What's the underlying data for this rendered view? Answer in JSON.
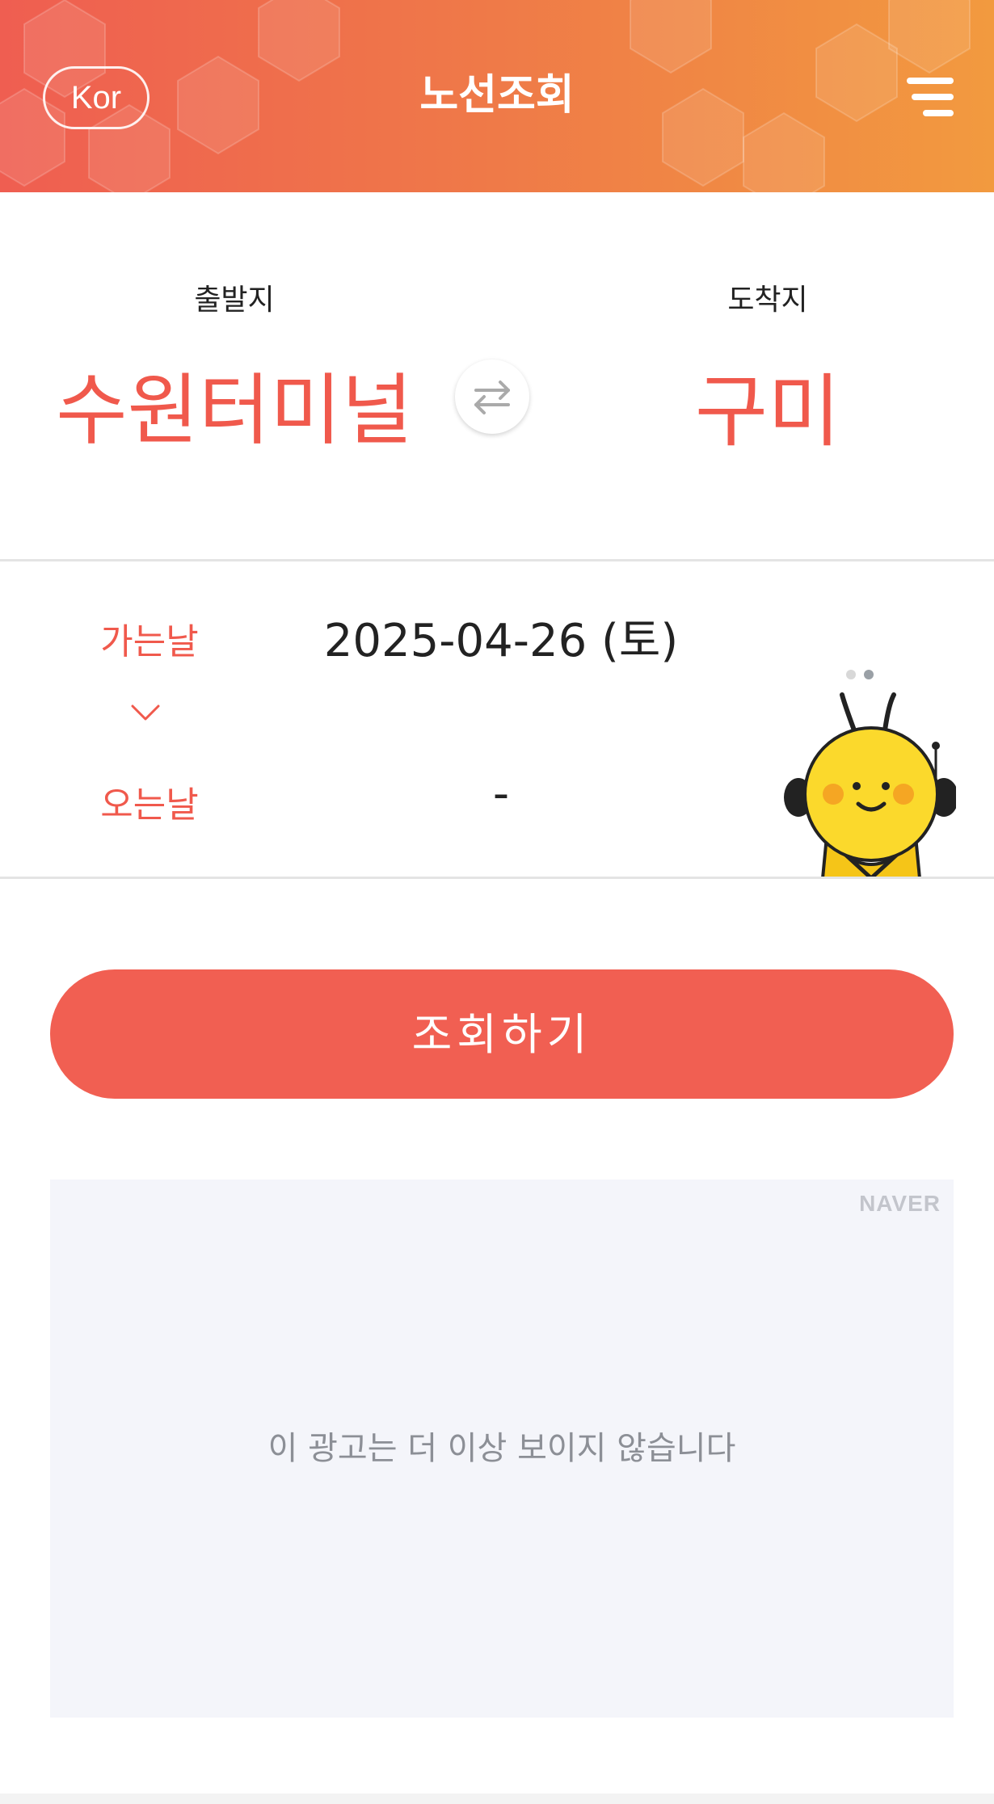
{
  "header": {
    "lang_label": "Kor",
    "title": "노선조회",
    "menu_icon": "hamburger-icon"
  },
  "route": {
    "departure_label": "출발지",
    "departure_value": "수원터미널",
    "arrival_label": "도착지",
    "arrival_value": "구미",
    "swap_icon": "swap-arrows-icon"
  },
  "dates": {
    "go_label": "가는날",
    "go_value": "2025-04-26 (토)",
    "return_label": "오는날",
    "return_value": "-"
  },
  "search_button": "조회하기",
  "ad": {
    "brand": "NAVER",
    "message": "이 광고는 더 이상 보이지 않습니다"
  },
  "colors": {
    "accent": "#f0594c",
    "header_start": "#ef5e51",
    "header_end": "#f29a3f"
  }
}
